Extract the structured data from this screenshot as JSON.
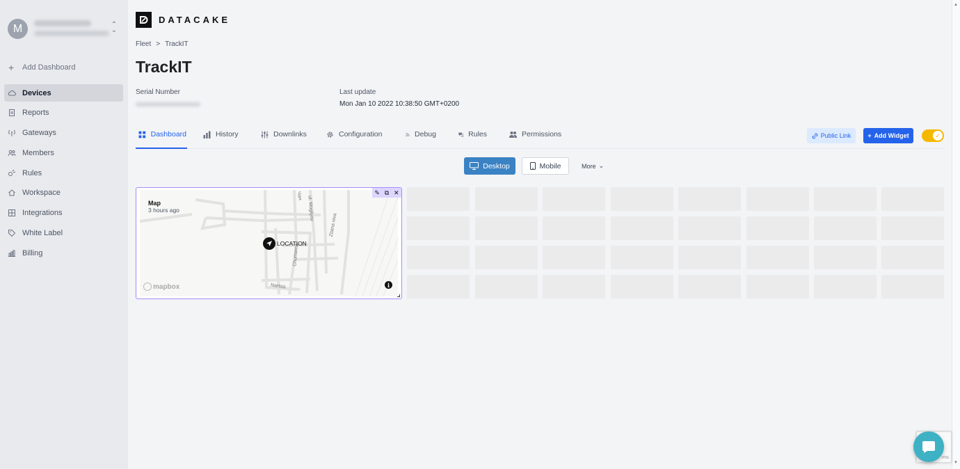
{
  "user": {
    "avatar_letter": "M"
  },
  "sidebar": {
    "add_dashboard": "Add Dashboard",
    "items": [
      {
        "label": "Devices",
        "icon": "cloud-icon",
        "active": true
      },
      {
        "label": "Reports",
        "icon": "document-icon"
      },
      {
        "label": "Gateways",
        "icon": "antenna-icon"
      },
      {
        "label": "Members",
        "icon": "users-icon"
      },
      {
        "label": "Rules",
        "icon": "rules-icon"
      },
      {
        "label": "Workspace",
        "icon": "home-icon"
      },
      {
        "label": "Integrations",
        "icon": "integrations-icon"
      },
      {
        "label": "White Label",
        "icon": "tag-icon"
      },
      {
        "label": "Billing",
        "icon": "billing-icon"
      }
    ]
  },
  "brand": {
    "name": "DATACAKE"
  },
  "breadcrumb": {
    "parent": "Fleet",
    "separator": ">",
    "current": "TrackIT"
  },
  "device": {
    "title": "TrackIT",
    "serial_label": "Serial Number",
    "last_update_label": "Last update",
    "last_update_value": "Mon Jan 10 2022 10:38:50 GMT+0200"
  },
  "tabs": [
    {
      "label": "Dashboard",
      "icon": "grid-icon",
      "active": true
    },
    {
      "label": "History",
      "icon": "bar-chart-icon"
    },
    {
      "label": "Downlinks",
      "icon": "sliders-icon"
    },
    {
      "label": "Configuration",
      "icon": "gear-icon"
    },
    {
      "label": "Debug",
      "icon": "rss-icon"
    },
    {
      "label": "Rules",
      "icon": "chat-icon"
    },
    {
      "label": "Permissions",
      "icon": "users-icon"
    }
  ],
  "actions": {
    "public_link": "Public Link",
    "add_widget": "Add Widget",
    "toggle_on": true
  },
  "view": {
    "desktop": "Desktop",
    "mobile": "Mobile",
    "more": "More"
  },
  "widget": {
    "title": "Map",
    "subtitle": "3 hours ago",
    "location_label": "LOCATION",
    "attribution": "mapbox",
    "streets": [
      "Chumerna",
      "ul. Mogilyov",
      "Zlatna niva",
      "Nartsis",
      "Чан"
    ]
  },
  "recaptcha": {
    "text": "rms"
  }
}
